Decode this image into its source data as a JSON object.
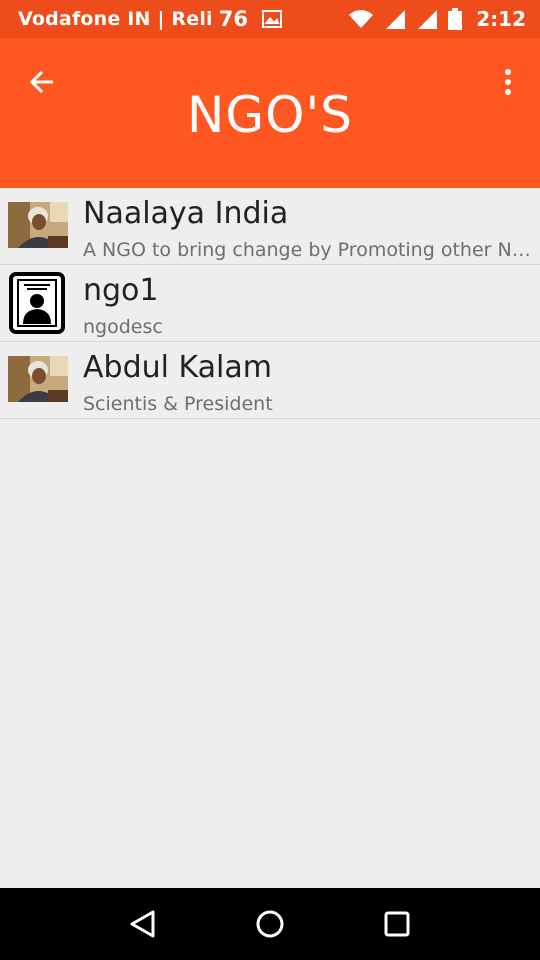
{
  "status_bar": {
    "carrier": "Vodafone IN | Reli",
    "carrier_count": "76",
    "time": "2:12",
    "icons": [
      "photo-icon",
      "wifi-icon",
      "signal-icon",
      "signal-icon",
      "battery-icon"
    ]
  },
  "app_bar": {
    "title": "NGO'S",
    "back_icon": "arrow-back-icon",
    "menu_icon": "more-vert-icon",
    "color": "#ff5722"
  },
  "ngos": [
    {
      "name": "Naalaya India",
      "description": "A NGO to bring change by Promoting other NGO's",
      "avatar": "photo-avatar"
    },
    {
      "name": "ngo1",
      "description": "ngodesc",
      "avatar": "contact-avatar"
    },
    {
      "name": "Abdul Kalam",
      "description": "Scientis & President",
      "avatar": "photo-avatar"
    }
  ],
  "nav_bar": {
    "icons": [
      "back-triangle-icon",
      "home-circle-icon",
      "recents-square-icon"
    ]
  }
}
